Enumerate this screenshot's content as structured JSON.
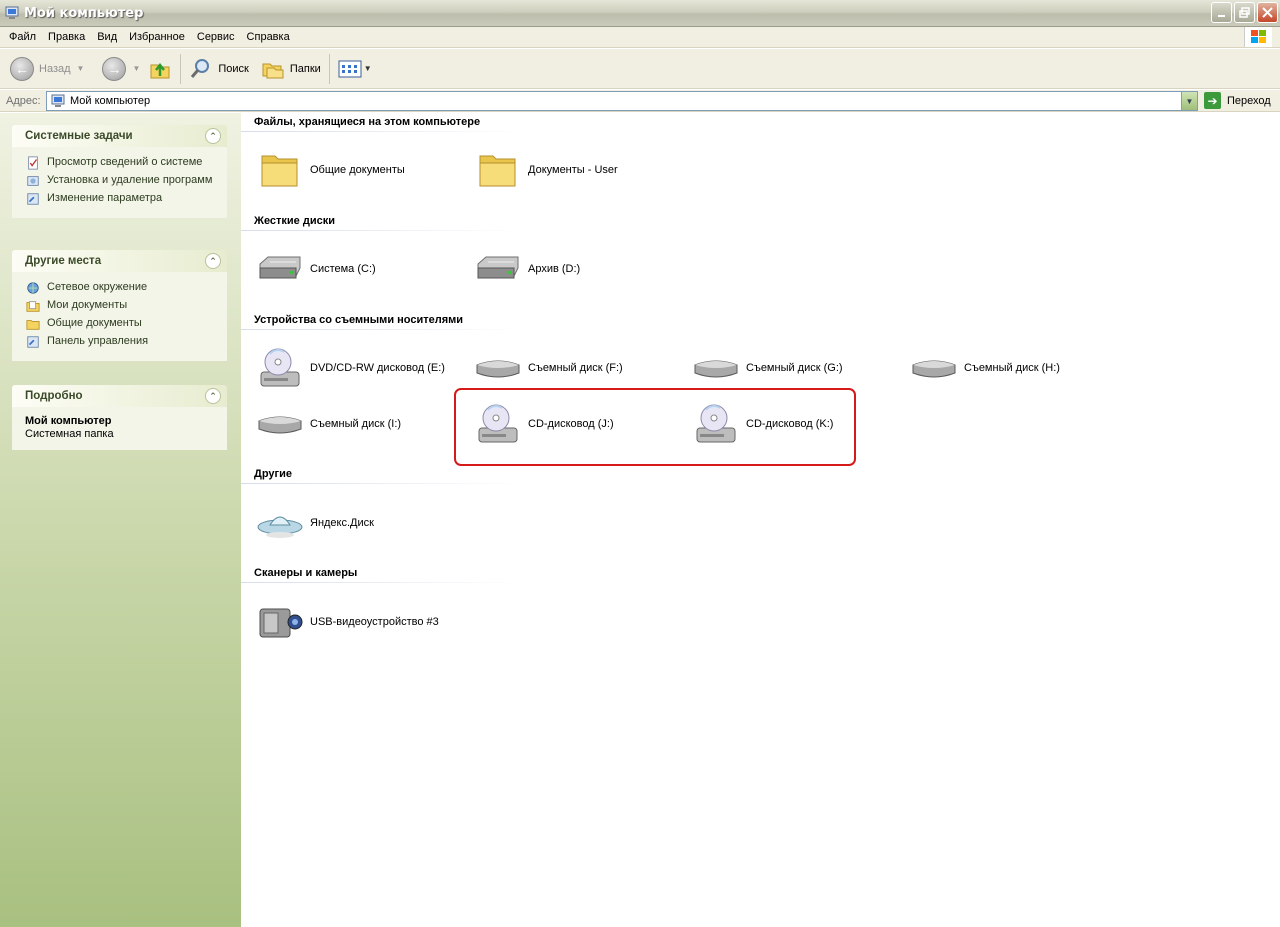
{
  "window": {
    "title": "Мой компьютер"
  },
  "menu": {
    "items": [
      "Файл",
      "Правка",
      "Вид",
      "Избранное",
      "Сервис",
      "Справка"
    ]
  },
  "toolbar": {
    "back": "Назад",
    "search": "Поиск",
    "folders": "Папки"
  },
  "address": {
    "label": "Адрес:",
    "value": "Мой компьютер",
    "go": "Переход"
  },
  "left": {
    "system_tasks": {
      "title": "Системные задачи",
      "items": [
        "Просмотр сведений о системе",
        "Установка и удаление программ",
        "Изменение параметра"
      ]
    },
    "other_places": {
      "title": "Другие места",
      "items": [
        "Сетевое окружение",
        "Мои документы",
        "Общие документы",
        "Панель управления"
      ]
    },
    "details": {
      "title": "Подробно",
      "name": "Мой компьютер",
      "type": "Системная папка"
    }
  },
  "groups": {
    "files": {
      "title": "Файлы, хранящиеся на этом компьютере",
      "items": [
        "Общие документы",
        "Документы - User"
      ]
    },
    "hard_disks": {
      "title": "Жесткие диски",
      "items": [
        "Система (C:)",
        "Архив (D:)"
      ]
    },
    "removable": {
      "title": "Устройства со съемными носителями",
      "items": [
        "DVD/CD-RW дисковод (E:)",
        "Съемный диск (F:)",
        "Съемный диск (G:)",
        "Съемный диск (H:)",
        "Съемный диск (I:)",
        "CD-дисковод (J:)",
        "CD-дисковод (K:)"
      ]
    },
    "other": {
      "title": "Другие",
      "items": [
        "Яндекс.Диск"
      ]
    },
    "scanners": {
      "title": "Сканеры и камеры",
      "items": [
        "USB-видеоустройство #3"
      ]
    }
  },
  "colors": {
    "highlight": "#d51a1a",
    "left_pane": "#c8d6a8"
  }
}
